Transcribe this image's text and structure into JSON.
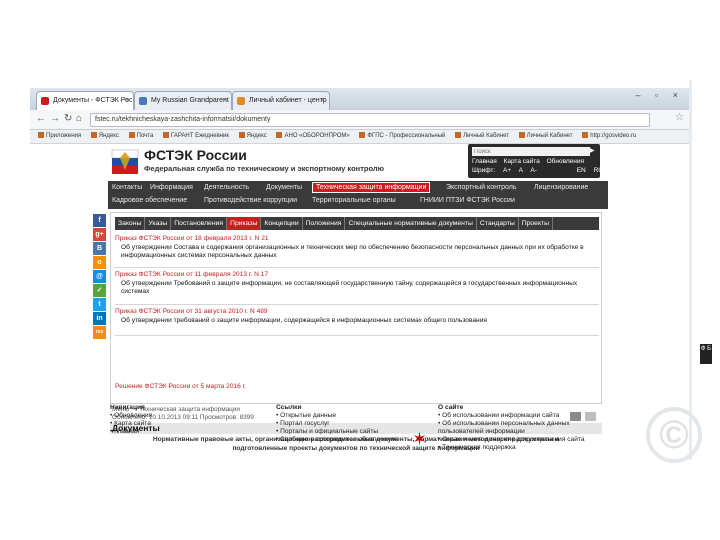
{
  "browser": {
    "tabs": [
      {
        "label": "Документы - ФСТЭК Рос",
        "color": "#c81e1e"
      },
      {
        "label": "My Russian Grandparent",
        "color": "#4a7ab5"
      },
      {
        "label": "Личный кабинет - центр",
        "color": "#e08a2a"
      }
    ],
    "url": "fstec.ru/tekhnicheskaya-zashchita-informatsii/dokumenty",
    "bookmarks": [
      "Приложения",
      "Яндекс",
      "Почта",
      "ГАРАНТ Ежедневник",
      "Яндекс",
      "АНО «ОБОРОНПРОМ»",
      "ФГПС - Профессиональный",
      "Личный Кабинет",
      "Личный Кабинет",
      "http://gosvideo.ru"
    ]
  },
  "header": {
    "title": "ФСТЭК России",
    "subtitle": "Федеральная служба по техническому и экспортному контролю",
    "search_placeholder": "Поиск",
    "util_links": [
      "Главная",
      "Карта сайта",
      "Обновления"
    ],
    "font_label": "Шрифт:",
    "font_sizes": [
      "A+",
      "A",
      "A-"
    ],
    "languages": [
      "EN",
      "RU"
    ]
  },
  "main_nav": {
    "row1": [
      "Контакты",
      "Информация",
      "Деятельность",
      "Документы",
      "Техническая защита информации",
      "Экспортный контроль",
      "Лицензирование"
    ],
    "row2": [
      "Кадровое обеспечение",
      "Противодействие коррупции",
      "Территориальные органы",
      "ГНИИИ ПТЗИ ФСТЭК России"
    ],
    "active": "Техническая защита информации"
  },
  "social": [
    {
      "label": "f",
      "color": "#3b5998"
    },
    {
      "label": "g+",
      "color": "#d34836"
    },
    {
      "label": "B",
      "color": "#4a76a8"
    },
    {
      "label": "o",
      "color": "#f29200"
    },
    {
      "label": "@",
      "color": "#168de2"
    },
    {
      "label": "✓",
      "color": "#5ea13e"
    },
    {
      "label": "t",
      "color": "#1da1f2"
    },
    {
      "label": "in",
      "color": "#0077b5"
    },
    {
      "label": "rss",
      "color": "#f68a1f"
    }
  ],
  "category_tabs": [
    "Законы",
    "Указы",
    "Постановления",
    "Приказы",
    "Концепции",
    "Положения",
    "Специальные нормативные документы",
    "Стандарты",
    "Проекты"
  ],
  "active_category": "Приказы",
  "documents": [
    {
      "title": "Приказ ФСТЭК России от 18 февраля 2013 г. N 21",
      "description": "Об утверждении Состава и содержания организационных и технических мер по обеспечению безопасности персональных данных при их обработке в информационных системах персональных данных"
    },
    {
      "title": "Приказ ФСТЭК России от 11 февраля 2013 г. N 17",
      "description": "Об утверждении Требований о защите информации, не составляющей государственную тайну, содержащейся в государственных информационных системах"
    },
    {
      "title": "Приказ ФСТЭК России от 31 августа 2010 г. N 489",
      "description": "Об утверждении требований о защите информации, содержащейся в информационных системах общего пользования"
    }
  ],
  "footnote": "Решение ФСТЭК России от 5 марта 2016 г.",
  "breadcrumb": "Меню → Техническая защита информации",
  "updated": "Обновлено: 10.10.2013 09:11    Просмотров: 8399",
  "page_title": "Документы",
  "page_desc_line1": "Нормативные правовые акты, организационно-распорядительные документы, нормативные и методические документы и",
  "page_desc_line2": "подготовленные проекты документов по технической защите информации",
  "footer": {
    "cols": [
      {
        "head": "Навигация",
        "items": [
          "Обновления",
          "Карта сайта",
          "Главная"
        ]
      },
      {
        "head": "Ссылки",
        "items": [
          "Открытые данные",
          "Портал госуслуг",
          "Порталы и официальные сайты",
          "Свободное программное обеспечение"
        ]
      },
      {
        "head": "О сайте",
        "items": [
          "Об использовании информации сайта",
          "Об использовании персональных данных пользователей информации",
          "Ограничение и запрет распространения сайта",
          "Техническая поддержка"
        ]
      }
    ]
  },
  "side_badge": "Ф Б",
  "watermark": "©"
}
